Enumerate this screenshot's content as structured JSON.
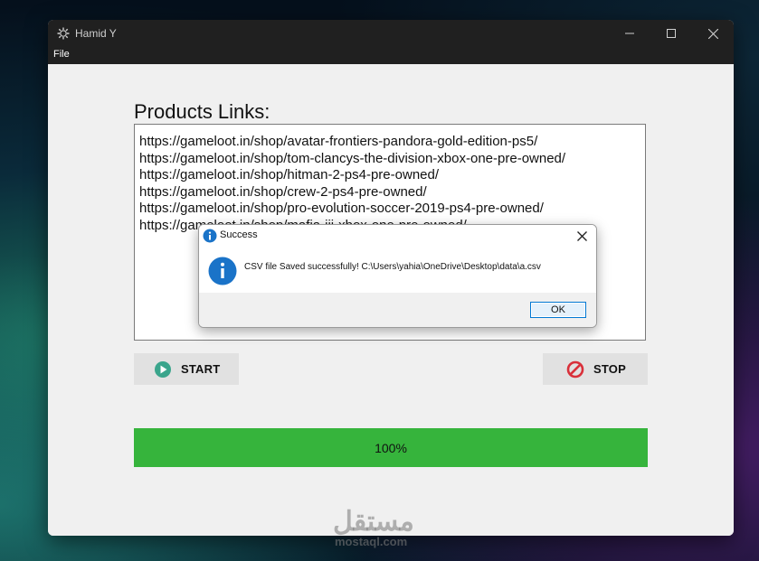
{
  "window": {
    "title": "Hamid Y",
    "menu": [
      "File"
    ]
  },
  "main": {
    "links_label": "Products Links:",
    "links": [
      "https://gameloot.in/shop/avatar-frontiers-pandora-gold-edition-ps5/",
      "https://gameloot.in/shop/tom-clancys-the-division-xbox-one-pre-owned/",
      "https://gameloot.in/shop/hitman-2-ps4-pre-owned/",
      "https://gameloot.in/shop/crew-2-ps4-pre-owned/",
      "https://gameloot.in/shop/pro-evolution-soccer-2019-ps4-pre-owned/",
      "https://gameloot.in/shop/mafia-iii-xbox-one-pre-owned/"
    ],
    "start_label": "START",
    "stop_label": "STOP",
    "progress": {
      "value": 1.0,
      "label": "100%"
    }
  },
  "dialog": {
    "title": "Success",
    "message": "CSV file Saved successfully! C:\\Users\\yahia\\OneDrive\\Desktop\\data\\a.csv",
    "ok_label": "OK"
  },
  "watermark": {
    "arabic": "مستقل",
    "latin": "mostaql.com"
  },
  "colors": {
    "titlebar": "#202020",
    "progress_fill": "#36b43c",
    "start_icon": "#3aa58c",
    "stop_icon": "#d9303a",
    "info_icon": "#1a73c8",
    "ok_border": "#0078d4"
  },
  "icons": {
    "app": "gear-icon",
    "start": "play-circle-icon",
    "stop": "prohibited-icon",
    "dialog": "info-icon"
  }
}
